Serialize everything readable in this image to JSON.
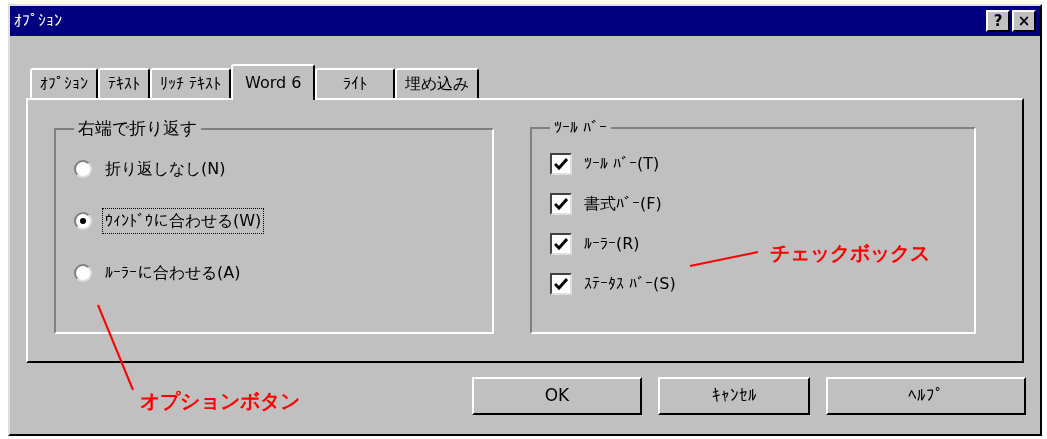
{
  "window": {
    "title": "ｵﾌﾟｼｮﾝ",
    "title_buttons": [
      "?",
      "×"
    ]
  },
  "tabs": [
    {
      "label": "ｵﾌﾟｼｮﾝ",
      "selected": false
    },
    {
      "label": "ﾃｷｽﾄ",
      "selected": false
    },
    {
      "label": "ﾘｯﾁ ﾃｷｽﾄ",
      "selected": false
    },
    {
      "label": "Word 6",
      "selected": true
    },
    {
      "label": "ﾗｲﾄ",
      "selected": false
    },
    {
      "label": "埋め込み",
      "selected": false
    }
  ],
  "wrap_group": {
    "title": "右端で折り返す",
    "options": [
      {
        "label": "折り返しなし(N)",
        "selected": false
      },
      {
        "label": "ｳｨﾝﾄﾞｳに合わせる(W)",
        "selected": true
      },
      {
        "label": "ﾙｰﾗｰに合わせる(A)",
        "selected": false
      }
    ]
  },
  "toolbar_group": {
    "title": "ﾂｰﾙ ﾊﾞｰ",
    "options": [
      {
        "label": "ﾂｰﾙ ﾊﾞｰ(T)",
        "checked": true
      },
      {
        "label": "書式ﾊﾞｰ(F)",
        "checked": true
      },
      {
        "label": "ﾙｰﾗｰ(R)",
        "checked": true
      },
      {
        "label": "ｽﾃｰﾀｽ ﾊﾞｰ(S)",
        "checked": true
      }
    ]
  },
  "buttons": [
    "OK",
    "ｷｬﾝｾﾙ",
    "ﾍﾙﾌﾟ"
  ],
  "annotations": [
    {
      "text": "チェックボックス"
    },
    {
      "text": "オプションボタン"
    }
  ]
}
